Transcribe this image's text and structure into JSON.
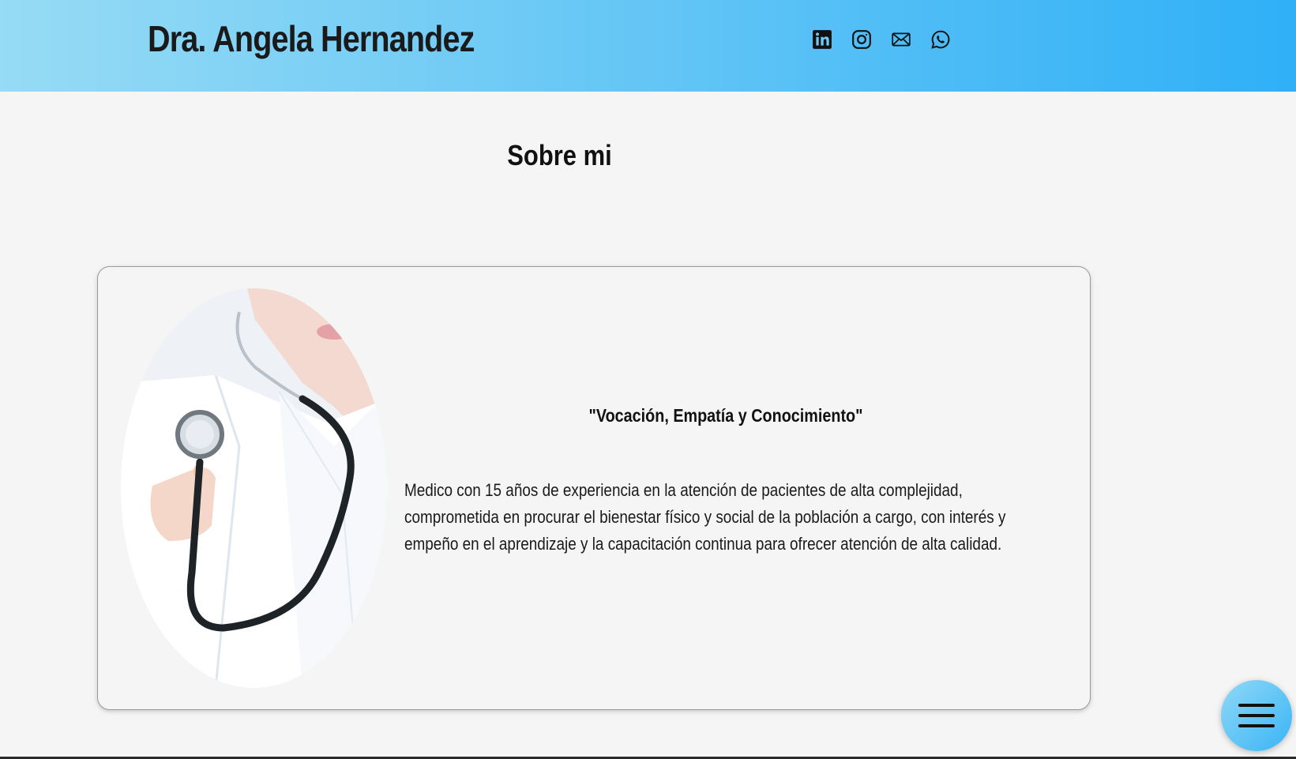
{
  "header": {
    "title": "Dra. Angela Hernandez",
    "social_icons": [
      "linkedin-icon",
      "instagram-icon",
      "mail-icon",
      "whatsapp-icon"
    ]
  },
  "about": {
    "heading": "Sobre mi",
    "quote": "\"Vocación, Empatía y Conocimiento\"",
    "bio": "Medico con 15 años de experiencia en la atención de pacientes de alta complejidad, comprometida en procurar el bienestar físico y social de la población a cargo, con interés y empeño en el aprendizaje y la capacitación continua para ofrecer atención de alta calidad.",
    "photo_icon": "doctor-with-stethoscope-photo"
  },
  "menu": {
    "icon": "hamburger-menu-icon"
  },
  "colors": {
    "header_gradient_start": "#97dbf5",
    "header_gradient_end": "#2fb0f7",
    "background": "#f5f5f5",
    "text": "#111111"
  }
}
